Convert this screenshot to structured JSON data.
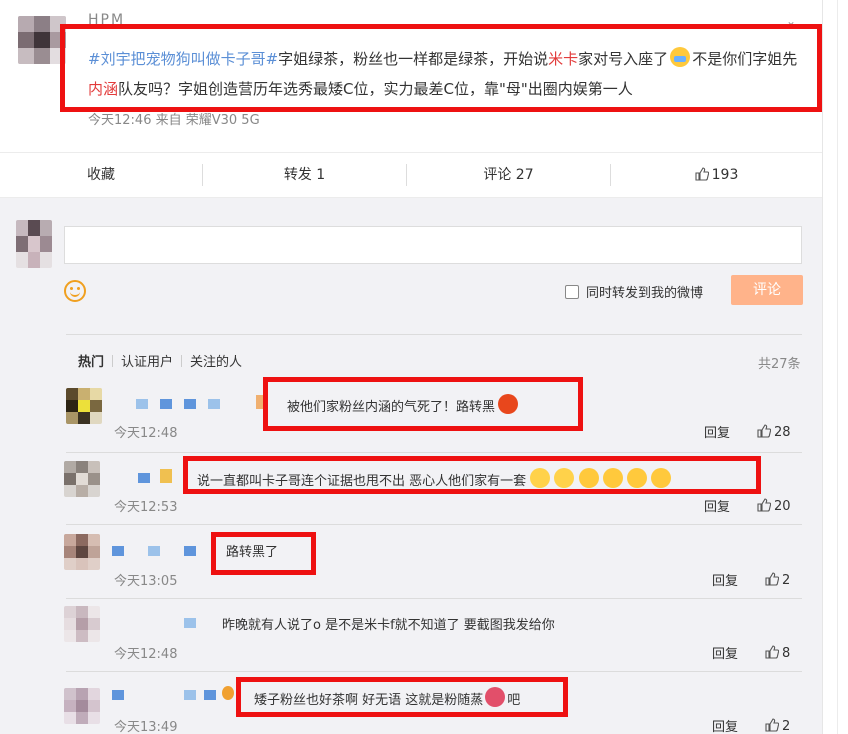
{
  "post": {
    "author_name": "HPM",
    "topic": "#刘宇把宠物狗叫做卡子哥#",
    "text_1": "字姐绿茶，粉丝也一样都是绿茶，开始说",
    "highlight_1": "米卡",
    "text_2": "家对号入座了",
    "text_3": "不是你们字姐先",
    "highlight_2": "内涵",
    "text_4": "队友吗？字姐创造营历年选秀最矮C位，实力最差C位，靠\"母\"出圈内娱第一人",
    "meta": "今天12:46  来自 荣耀V30 5G"
  },
  "actions": {
    "favorite": "收藏",
    "repost": "转发 1",
    "comment": "评论 27",
    "like": "193"
  },
  "composer": {
    "sync_label": "同时转发到我的微博",
    "submit_label": "评论"
  },
  "tabs": {
    "hot": "热门",
    "verified": "认证用户",
    "following": "关注的人",
    "total": "共27条"
  },
  "comments": [
    {
      "text": "被他们家粉丝内涵的气死了！路转黑",
      "time": "今天12:48",
      "reply": "回复",
      "likes": "28"
    },
    {
      "text": "说一直都叫卡子哥连个证据也甩不出 恶心人他们家有一套",
      "time": "今天12:53",
      "reply": "回复",
      "likes": "20"
    },
    {
      "text": "路转黑了",
      "time": "今天13:05",
      "reply": "回复",
      "likes": "2"
    },
    {
      "text": "昨晚就有人说了o 是不是米卡f就不知道了 要截图我发给你",
      "time": "今天12:48",
      "reply": "回复",
      "likes": "8"
    },
    {
      "text": "矮子粉丝也好茶啊 好无语 这就是粉随蒸",
      "text_suffix": "吧",
      "time": "今天13:49",
      "reply": "回复",
      "likes": "2"
    }
  ],
  "colors": {
    "highlight_box": "#ee1111",
    "topic": "#5b8fd6",
    "keyword": "#e23b3b",
    "submit_button": "#ffb38a"
  }
}
